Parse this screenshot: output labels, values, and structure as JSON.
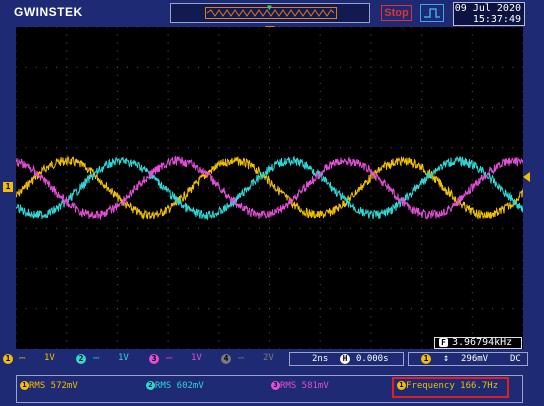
{
  "header": {
    "brand": "GWINSTEK",
    "run_state": "Stop",
    "date": "09 Jul 2020",
    "time": "15:37:49"
  },
  "screen": {
    "ch1_marker": "1",
    "frequency_badge": "F",
    "frequency_counter": "3.96794kHz"
  },
  "status": {
    "channels": [
      {
        "num": "1",
        "vdiv": "1V",
        "color": "#f0bf00",
        "active": true
      },
      {
        "num": "2",
        "vdiv": "1V",
        "color": "#2fd6d6",
        "active": true
      },
      {
        "num": "3",
        "vdiv": "1V",
        "color": "#e24ed6",
        "active": true
      },
      {
        "num": "4",
        "vdiv": "2V",
        "color": "#7a7a7a",
        "active": false
      }
    ],
    "timebase": "2ns",
    "h_badge": "H",
    "h_position": "0.000s",
    "trigger_source": "1",
    "trigger_level": "296mV",
    "trigger_coupling": "DC"
  },
  "measurements": [
    {
      "ch": "1",
      "label": "RMS 572mV",
      "color": "#f0bf00"
    },
    {
      "ch": "2",
      "label": "RMS 602mV",
      "color": "#2fd6d6"
    },
    {
      "ch": "3",
      "label": "RMS 581mV",
      "color": "#e24ed6"
    },
    {
      "ch": "1",
      "label": "Frequency 166.7Hz",
      "color": "#f0bf00"
    }
  ],
  "colors": {
    "ch1": "#f0bf00",
    "ch2": "#2fd6d6",
    "ch3": "#e24ed6",
    "background": "#1e2a73",
    "highlight": "#e02020"
  },
  "icons": {
    "trigger_mode": "rising-edge-icon",
    "trigger_slope": "updown-arrow-icon",
    "coupling": "dc-coupling-icon"
  }
}
